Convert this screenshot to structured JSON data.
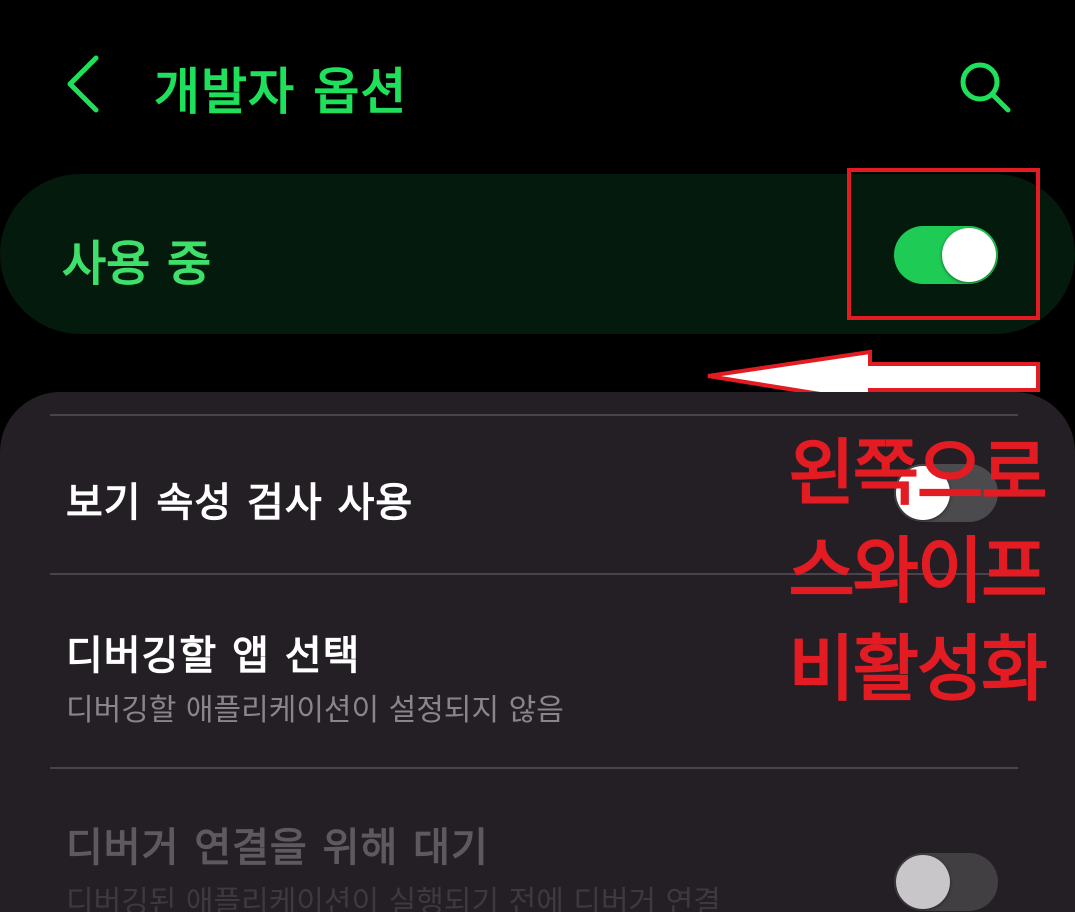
{
  "header": {
    "title": "개발자 옵션",
    "back_icon": "chevron-left-icon",
    "search_icon": "search-icon"
  },
  "master_switch": {
    "label": "사용 중",
    "state": "on"
  },
  "settings": [
    {
      "title": "보기 속성 검사 사용",
      "state": "off"
    },
    {
      "title": "디버깅할 앱 선택",
      "subtitle": "디버깅할 애플리케이션이 설정되지 않음"
    },
    {
      "title": "디버거 연결을 위해 대기",
      "subtitle": "디버깅된 애플리케이션이 실행되기 전에 디버거 연결",
      "state": "off",
      "disabled": true
    }
  ],
  "annotation": {
    "lines": [
      "왼쪽으로",
      "스와이프",
      "비활성화"
    ],
    "arrow_direction": "left"
  },
  "colors": {
    "accent": "#1ee05a",
    "toggle_on": "#1ecb54",
    "annotation_red": "#e31b23",
    "panel_bg": "#241e25",
    "master_bg": "#041a0d"
  }
}
